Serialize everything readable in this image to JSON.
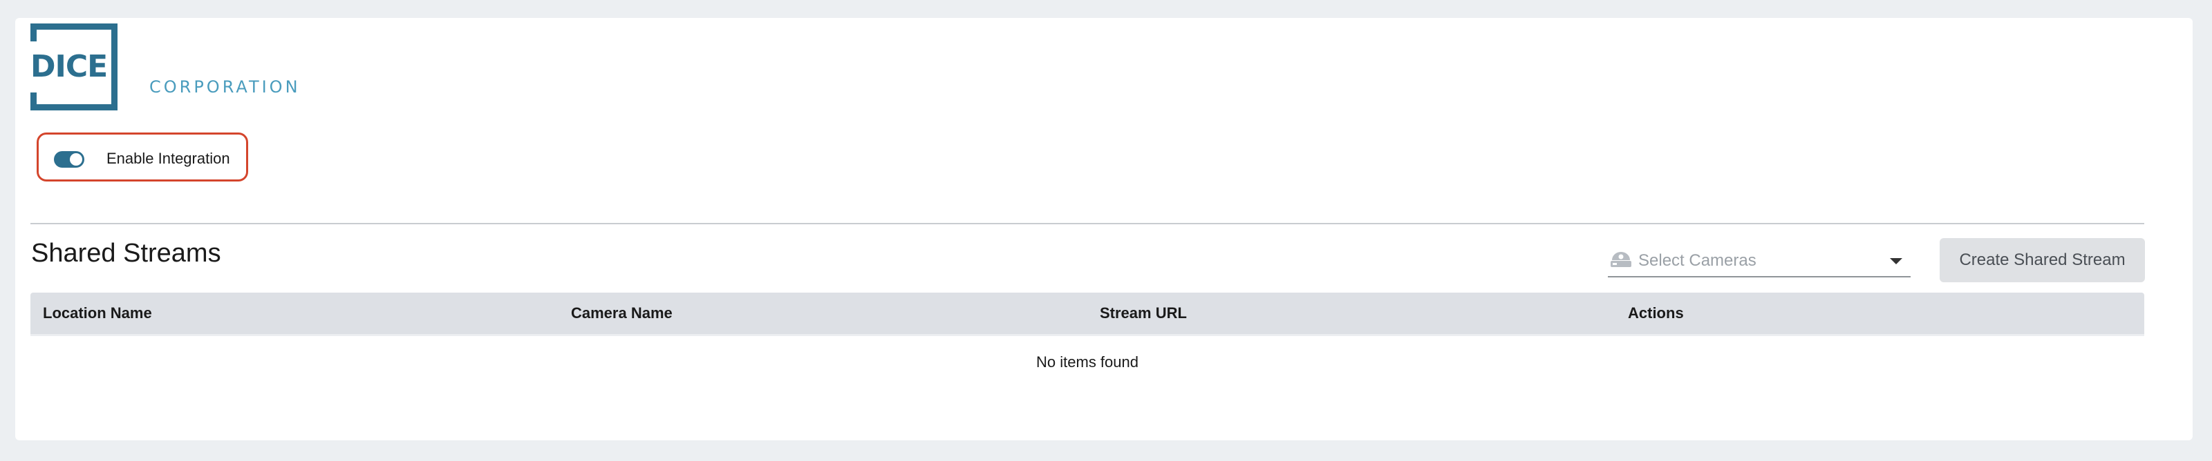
{
  "brand": {
    "logo_primary": "DICE",
    "logo_secondary": "CORPORATION",
    "primary_color": "#2c6f8f",
    "secondary_color": "#4a9cbd"
  },
  "integration": {
    "label": "Enable Integration",
    "enabled": true,
    "highlight_color": "#d4452c"
  },
  "shared_streams": {
    "title": "Shared Streams",
    "select_cameras": {
      "placeholder": "Select Cameras",
      "icon": "camera-icon"
    },
    "create_button_label": "Create Shared Stream",
    "table": {
      "columns": [
        "Location Name",
        "Camera Name",
        "Stream URL",
        "Actions"
      ],
      "rows": [],
      "empty_message": "No items found"
    }
  }
}
